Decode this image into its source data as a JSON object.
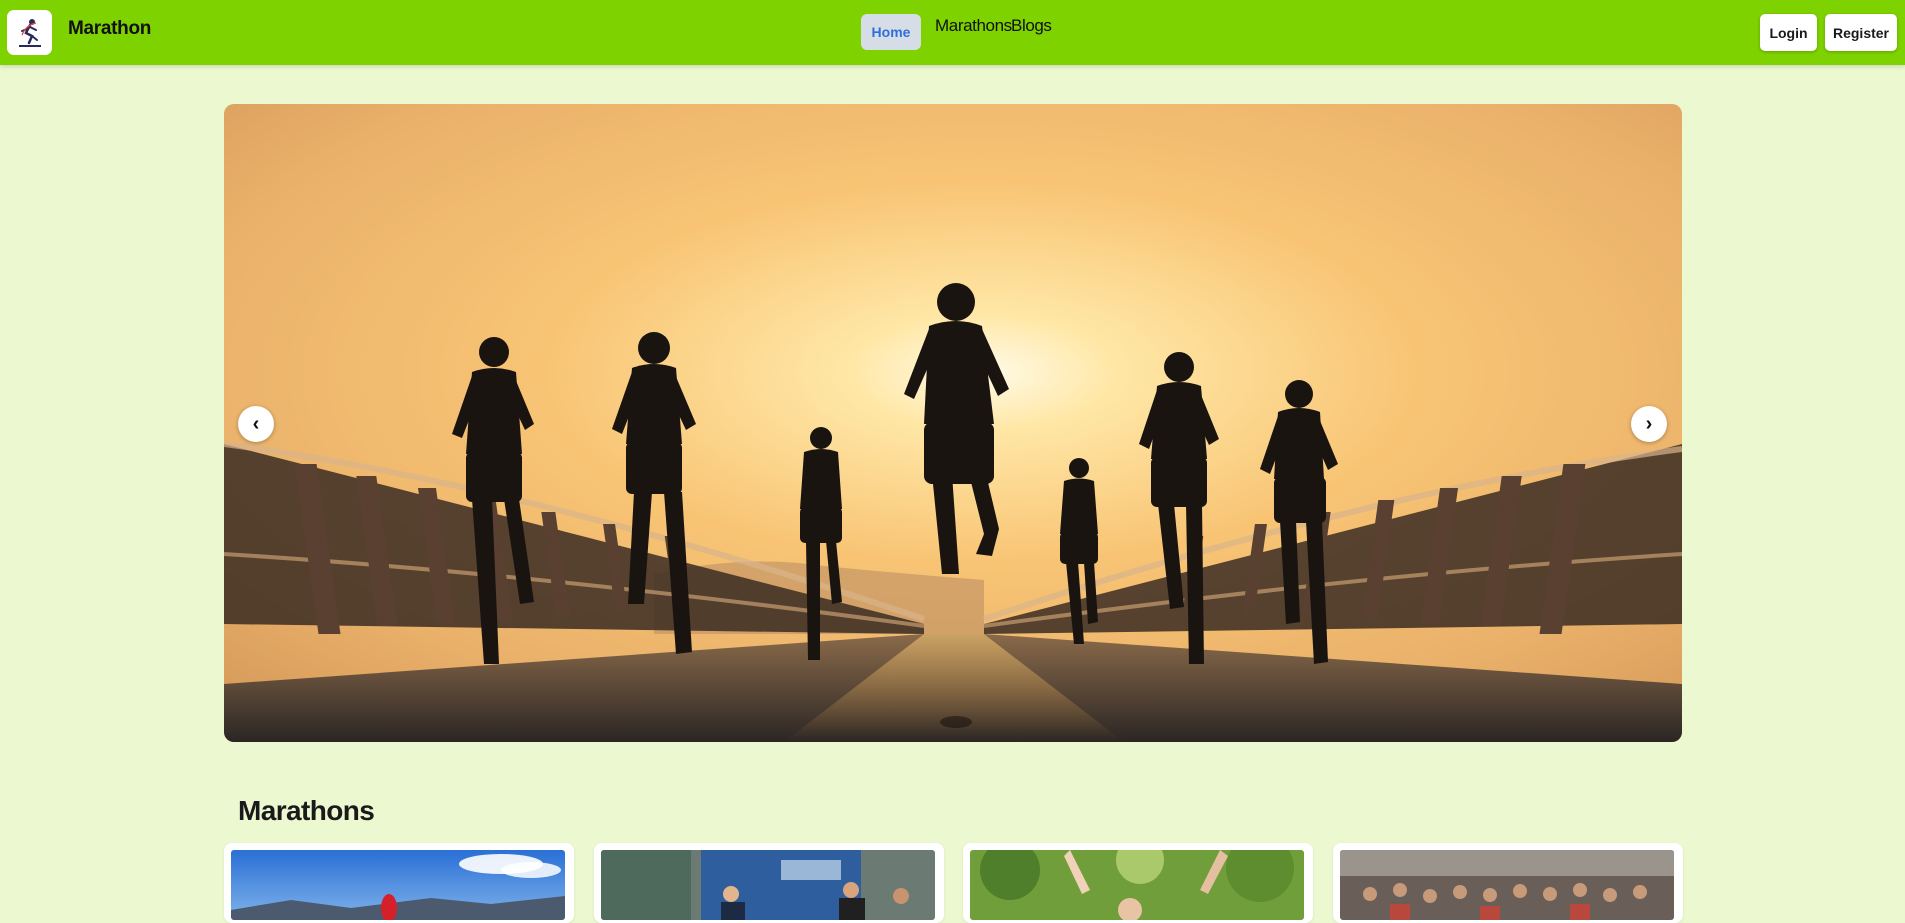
{
  "navbar": {
    "brand": "Marathon",
    "links": [
      {
        "label": "Home",
        "active": true
      },
      {
        "label": "Marathons",
        "active": false
      },
      {
        "label": "Blogs",
        "active": false
      }
    ],
    "login_label": "Login",
    "register_label": "Register",
    "logo_icon": "running-logo-icon"
  },
  "hero": {
    "prev_label": "‹",
    "next_label": "›",
    "image": "runners-at-sunset-on-bridge"
  },
  "marathons_section": {
    "title": "Marathons",
    "cards": [
      {
        "image": "runner-in-red-mountains"
      },
      {
        "image": "runners-crowd-city-street"
      },
      {
        "image": "runner-celebrating-park"
      },
      {
        "image": "marathon-start-crowd"
      }
    ]
  },
  "colors": {
    "navbar": "#7ed200",
    "page_background": "#ecf8cf",
    "home_active_bg": "#d7dde6",
    "home_active_text": "#2f6fdc"
  }
}
